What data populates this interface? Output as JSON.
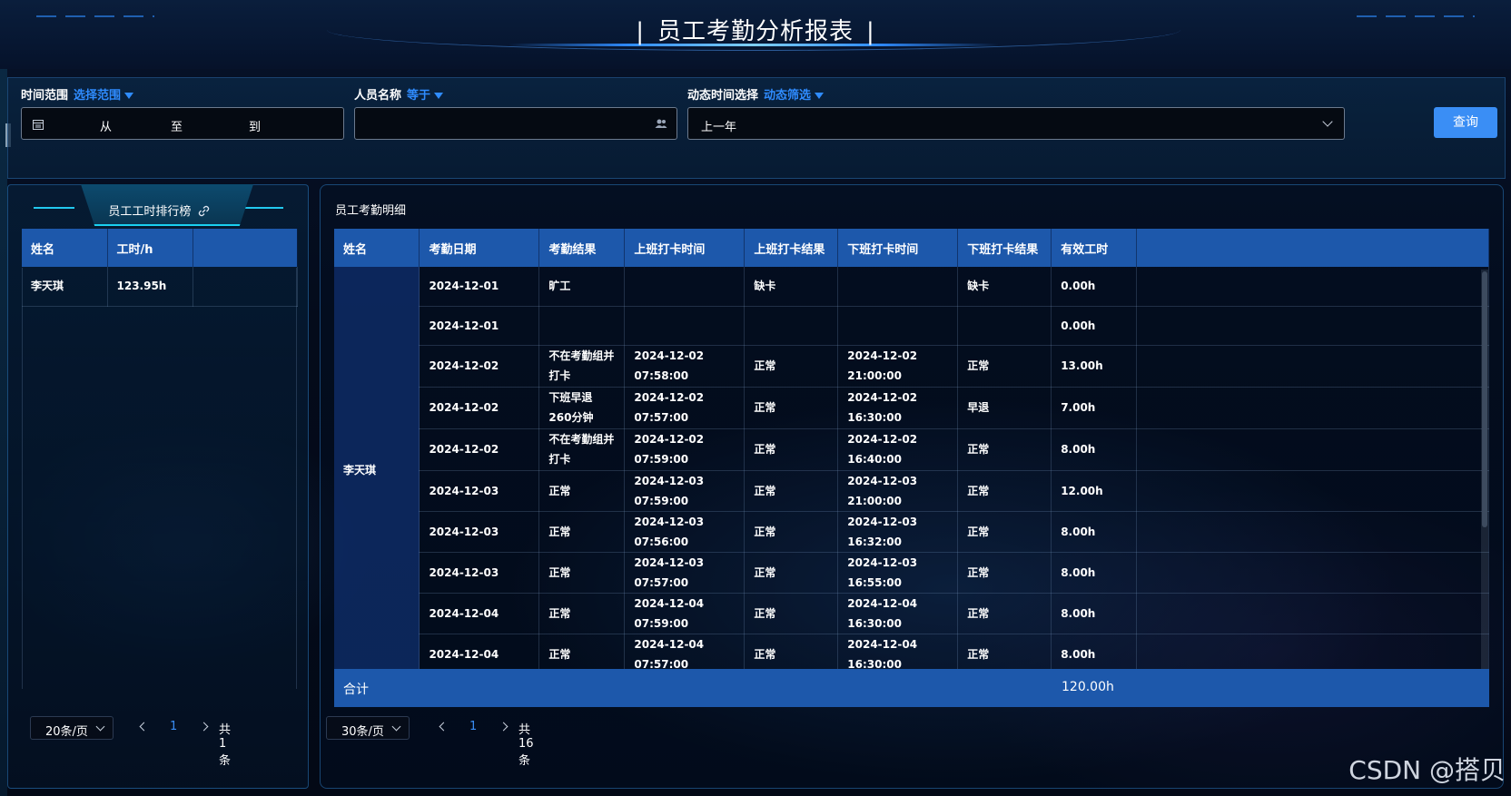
{
  "header": {
    "title": "员工考勤分析报表",
    "bar": "|"
  },
  "filters": {
    "time_range": {
      "label": "时间范围",
      "mode": "选择范围",
      "from": "从",
      "to": "至",
      "end": "到"
    },
    "person": {
      "label": "人员名称",
      "mode": "等于",
      "value": ""
    },
    "dynamic": {
      "label": "动态时间选择",
      "mode": "动态筛选",
      "value": "上一年"
    },
    "query_label": "查询"
  },
  "ranking": {
    "title": "员工工时排行榜",
    "columns": [
      "姓名",
      "工时/h",
      ""
    ],
    "rows": [
      {
        "name": "李天琪",
        "hours": "123.95h"
      }
    ],
    "pager": {
      "page_size": "20条/页",
      "page": "1",
      "total": "共 1 条"
    }
  },
  "detail": {
    "title": "员工考勤明细",
    "columns": [
      "姓名",
      "考勤日期",
      "考勤结果",
      "上班打卡时间",
      "上班打卡结果",
      "下班打卡时间",
      "下班打卡结果",
      "有效工时",
      ""
    ],
    "employee": "李天琪",
    "rows": [
      {
        "date": "2024-12-01",
        "result": "旷工",
        "in_time": "",
        "in_result": "缺卡",
        "out_time": "",
        "out_result": "缺卡",
        "hours": "0.00h"
      },
      {
        "date": "2024-12-01",
        "result": "",
        "in_time": "",
        "in_result": "",
        "out_time": "",
        "out_result": "",
        "hours": "0.00h"
      },
      {
        "date": "2024-12-02",
        "result": "不在考勤组并打卡",
        "in_time": "2024-12-02 07:58:00",
        "in_result": "正常",
        "out_time": "2024-12-02 21:00:00",
        "out_result": "正常",
        "hours": "13.00h"
      },
      {
        "date": "2024-12-02",
        "result": "下班早退260分钟",
        "in_time": "2024-12-02 07:57:00",
        "in_result": "正常",
        "out_time": "2024-12-02 16:30:00",
        "out_result": "早退",
        "hours": "7.00h"
      },
      {
        "date": "2024-12-02",
        "result": "不在考勤组并打卡",
        "in_time": "2024-12-02 07:59:00",
        "in_result": "正常",
        "out_time": "2024-12-02 16:40:00",
        "out_result": "正常",
        "hours": "8.00h"
      },
      {
        "date": "2024-12-03",
        "result": "正常",
        "in_time": "2024-12-03 07:59:00",
        "in_result": "正常",
        "out_time": "2024-12-03 21:00:00",
        "out_result": "正常",
        "hours": "12.00h"
      },
      {
        "date": "2024-12-03",
        "result": "正常",
        "in_time": "2024-12-03 07:56:00",
        "in_result": "正常",
        "out_time": "2024-12-03 16:32:00",
        "out_result": "正常",
        "hours": "8.00h"
      },
      {
        "date": "2024-12-03",
        "result": "正常",
        "in_time": "2024-12-03 07:57:00",
        "in_result": "正常",
        "out_time": "2024-12-03 16:55:00",
        "out_result": "正常",
        "hours": "8.00h"
      },
      {
        "date": "2024-12-04",
        "result": "正常",
        "in_time": "2024-12-04 07:59:00",
        "in_result": "正常",
        "out_time": "2024-12-04 16:30:00",
        "out_result": "正常",
        "hours": "8.00h"
      },
      {
        "date": "2024-12-04",
        "result": "正常",
        "in_time": "2024-12-04 07:57:00",
        "in_result": "正常",
        "out_time": "2024-12-04 16:30:00",
        "out_result": "正常",
        "hours": "8.00h"
      }
    ],
    "summary": {
      "label": "合计",
      "hours": "120.00h"
    },
    "pager": {
      "page_size": "30条/页",
      "page": "1",
      "total": "共 16 条"
    }
  },
  "watermark": "CSDN @搭贝",
  "colors": {
    "accent": "#3a8ef5",
    "table_header": "#1d58ab"
  }
}
